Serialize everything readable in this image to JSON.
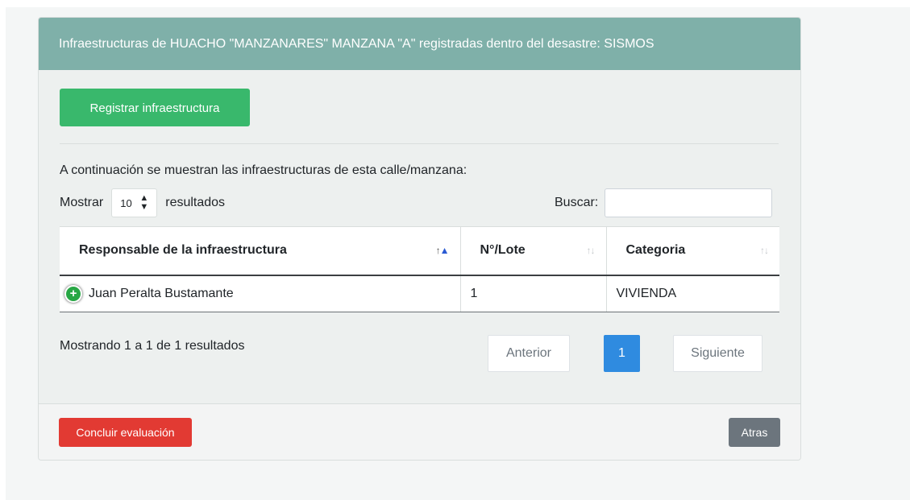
{
  "header": {
    "title": "Infraestructuras de HUACHO \"MANZANARES\" MANZANA \"A\" registradas dentro del desastre: SISMOS"
  },
  "actions": {
    "register_label": "Registrar infraestructura"
  },
  "intro_text": "A continuación se muestran las infraestructuras de esta calle/manzana:",
  "length_menu": {
    "prefix": "Mostrar",
    "selected": "10",
    "suffix": "resultados"
  },
  "search": {
    "label": "Buscar:",
    "value": "",
    "placeholder": ""
  },
  "table": {
    "columns": [
      {
        "label": "Responsable de la infraestructura",
        "sort": "ascending"
      },
      {
        "label": "N°/Lote",
        "sort": "none"
      },
      {
        "label": "Categoria",
        "sort": "none"
      }
    ],
    "rows": [
      {
        "responsable": "Juan Peralta Bustamante",
        "lote": "1",
        "categoria": "VIVIENDA"
      }
    ]
  },
  "table_info": "Mostrando 1 a 1 de 1 resultados",
  "pagination": {
    "previous": "Anterior",
    "current": "1",
    "next": "Siguiente"
  },
  "footer": {
    "conclude_label": "Concluir evaluación",
    "back_label": "Atras"
  },
  "colors": {
    "header_bg": "#7fb0a9",
    "register_button": "#39b86c",
    "conclude_button": "#e23a33",
    "back_button": "#6c757d",
    "active_page": "#2f8be0",
    "expand_icon": "#28a745"
  },
  "icons": {
    "expand_row": "plus-circle-icon",
    "select_arrows": "updown-arrows-icon",
    "sort": "sort-arrows-icon"
  }
}
